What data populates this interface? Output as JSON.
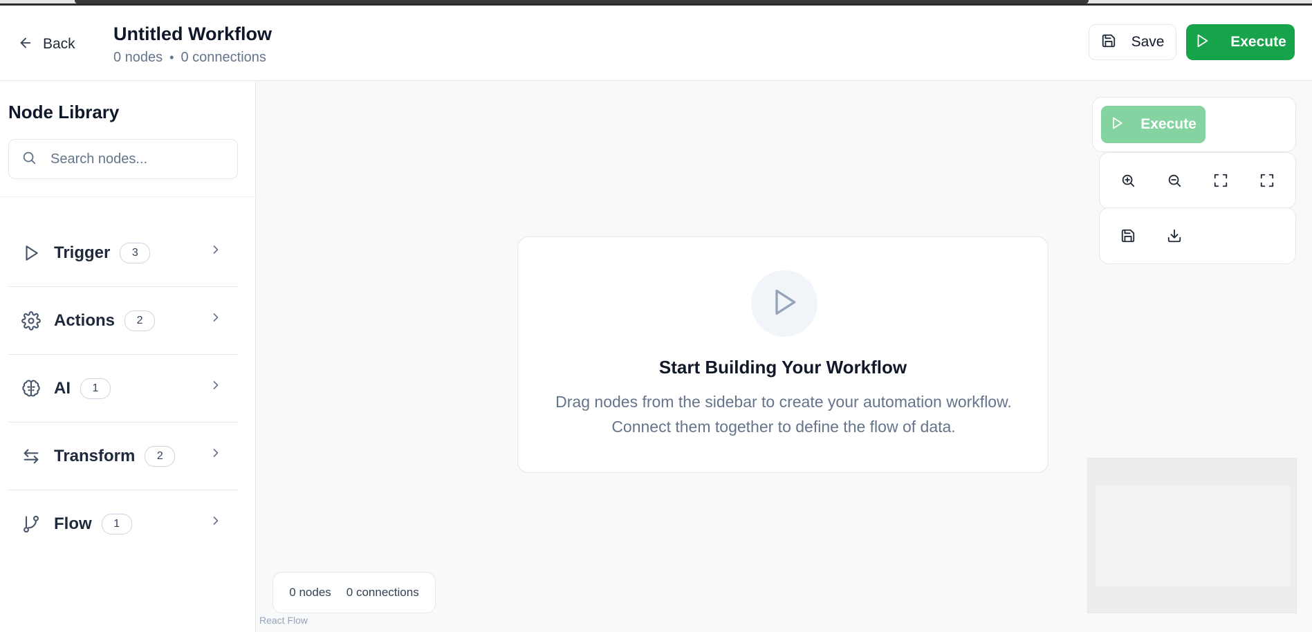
{
  "header": {
    "back_label": "Back",
    "title": "Untitled Workflow",
    "nodes_count": "0 nodes",
    "separator": "•",
    "connections_count": "0 connections",
    "save_label": "Save",
    "execute_label": "Execute"
  },
  "sidebar": {
    "title": "Node Library",
    "search_placeholder": "Search nodes...",
    "categories": [
      {
        "label": "Trigger",
        "count": "3",
        "icon": "play-icon"
      },
      {
        "label": "Actions",
        "count": "2",
        "icon": "gear-icon"
      },
      {
        "label": "AI",
        "count": "1",
        "icon": "brain-icon"
      },
      {
        "label": "Transform",
        "count": "2",
        "icon": "arrows-icon"
      },
      {
        "label": "Flow",
        "count": "1",
        "icon": "branch-icon"
      }
    ]
  },
  "canvas": {
    "empty_title": "Start Building Your Workflow",
    "empty_description": "Drag nodes from the sidebar to create your automation workflow. Connect them together to define the flow of data.",
    "execute_label": "Execute",
    "controls": [
      "zoom-in-icon",
      "zoom-out-icon",
      "fit-view-icon",
      "fullscreen-icon",
      "save-icon",
      "download-icon"
    ],
    "stats_nodes": "0 nodes",
    "stats_connections": "0 connections",
    "attribution": "React Flow"
  },
  "colors": {
    "accent": "#16a34a",
    "accent_disabled": "#86d3a2",
    "canvas_bg": "#f8f9fb",
    "muted_text": "#64748b"
  }
}
